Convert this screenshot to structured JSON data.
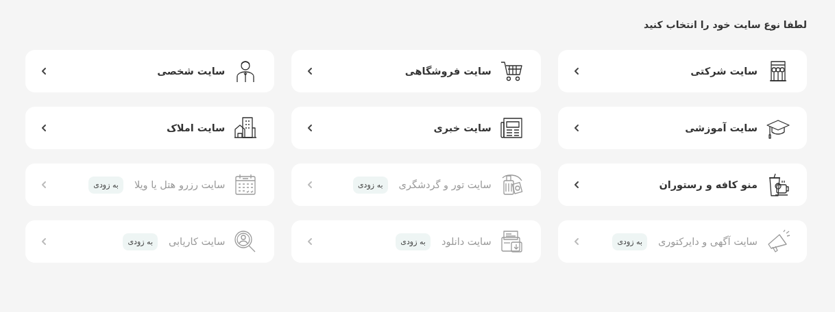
{
  "heading": "لطفا نوع سایت خود را انتخاب کنید",
  "items": [
    {
      "label": "سایت شرکتی",
      "disabled": false
    },
    {
      "label": "سایت فروشگاهی",
      "disabled": false
    },
    {
      "label": "سایت شخصی",
      "disabled": false
    },
    {
      "label": "سایت آموزشی",
      "disabled": false
    },
    {
      "label": "سایت خبری",
      "disabled": false
    },
    {
      "label": "سایت املاک",
      "disabled": false
    },
    {
      "label": "منو کافه و رستوران",
      "disabled": false
    },
    {
      "label": "سایت تور و گردشگری",
      "disabled": true,
      "badge": "به زودی"
    },
    {
      "label": "سایت رزرو هتل یا ویلا",
      "disabled": true,
      "badge": "به زودی"
    },
    {
      "label": "سایت آگهی و دایرکتوری",
      "disabled": true,
      "badge": "به زودی"
    },
    {
      "label": "سایت دانلود",
      "disabled": true,
      "badge": "به زودی"
    },
    {
      "label": "سایت کاریابی",
      "disabled": true,
      "badge": "به زودی"
    }
  ]
}
